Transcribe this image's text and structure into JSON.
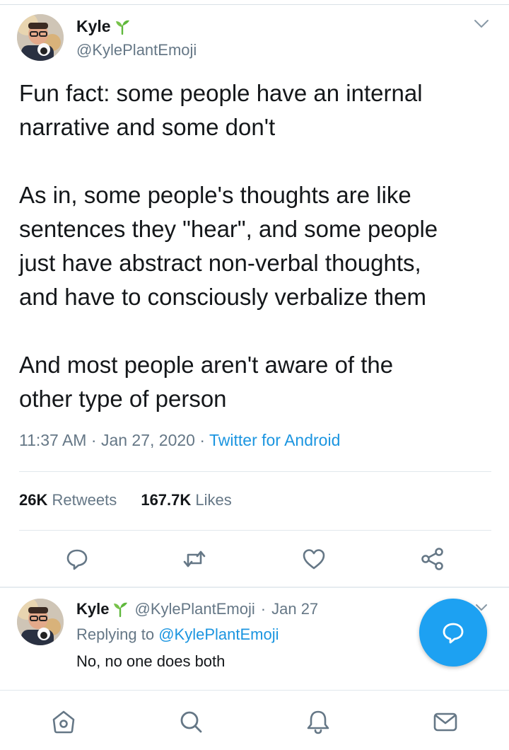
{
  "tweet": {
    "author": {
      "name": "Kyle",
      "handle": "@KylePlantEmoji",
      "name_emoji": "sprout-icon"
    },
    "paragraphs": [
      [
        "Fun fact: some people have an internal",
        "narrative and some don't"
      ],
      [
        "As in, some people's thoughts are like",
        "sentences they \"hear\", and some people",
        "just have abstract non-verbal thoughts,",
        "and have to consciously verbalize them"
      ],
      [
        "And most people aren't aware of the",
        "other type of person"
      ]
    ],
    "time": "11:37 AM",
    "date": "Jan 27, 2020",
    "separator": "·",
    "source": "Twitter for Android",
    "retweets_count": "26K",
    "retweets_label": "Retweets",
    "likes_count": "167.7K",
    "likes_label": "Likes",
    "actions": [
      "reply-icon",
      "retweet-icon",
      "like-icon",
      "share-icon"
    ]
  },
  "reply": {
    "author": {
      "name": "Kyle",
      "handle": "@KylePlantEmoji"
    },
    "separator": "·",
    "date": "Jan 27",
    "replying_prefix": "Replying to",
    "replying_to": "@KylePlantEmoji",
    "text": "No, no one does both"
  },
  "fab": {
    "icon": "compose-reply-icon"
  },
  "bottom_nav": [
    "home-icon",
    "search-icon",
    "notifications-icon",
    "messages-icon"
  ],
  "colors": {
    "accent": "#1da1f2",
    "link": "#1b95e0",
    "muted": "#657786",
    "text": "#14171a"
  }
}
